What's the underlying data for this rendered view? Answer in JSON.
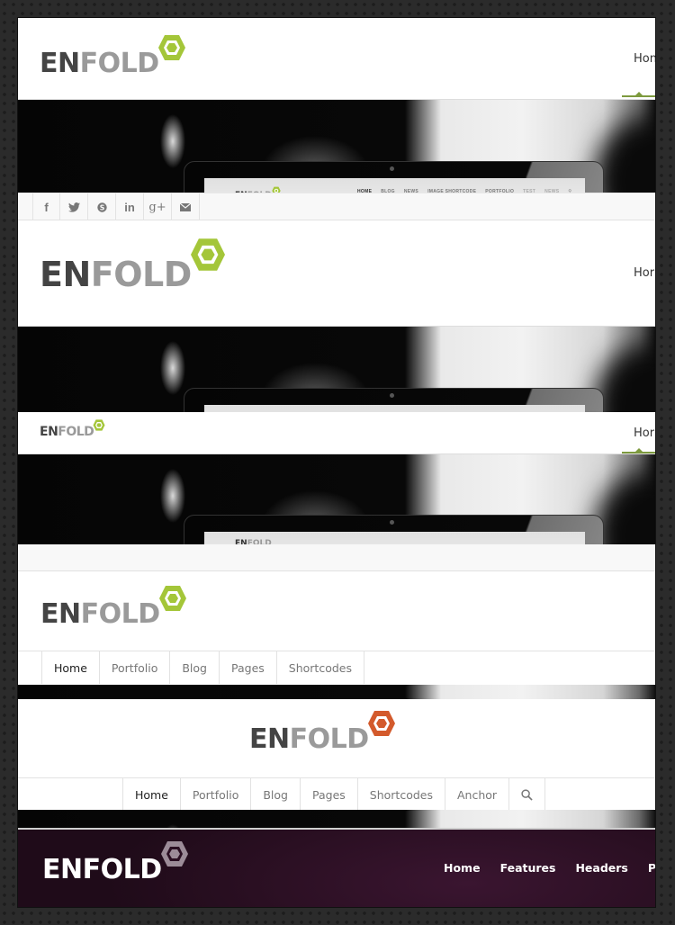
{
  "brand": {
    "logo_en": "EN",
    "logo_fold": "FOLD",
    "accent_green": "#a4c639",
    "accent_orange": "#d35a2c",
    "accent_muted": "#9c8c98",
    "nav_active_color": "#7d9a3e",
    "dark_header_color": "#2a0f22"
  },
  "variants": [
    {
      "name": "header-large-with-social-bar",
      "nav_visible": "Hon",
      "laptop_screen": {
        "nav": [
          "HOME",
          "BLOG",
          "NEWS",
          "IMAGE SHORTCODE",
          "PORTFOLIO",
          "TEST",
          "NEWS"
        ]
      },
      "social_icons": [
        "facebook-icon",
        "twitter-icon",
        "skype-icon",
        "linkedin-icon",
        "googleplus-icon",
        "mail-icon"
      ],
      "social_glyphs": [
        "f",
        "t",
        "S",
        "in",
        "g+",
        "✉"
      ]
    },
    {
      "name": "header-extra-large",
      "nav_visible": "Hor"
    },
    {
      "name": "header-small-compact",
      "nav_visible": "Hor"
    },
    {
      "name": "header-logo-left-menu-below",
      "menu": [
        "Home",
        "Portfolio",
        "Blog",
        "Pages",
        "Shortcodes"
      ]
    },
    {
      "name": "header-logo-centered-menu-below",
      "menu": [
        "Home",
        "Portfolio",
        "Blog",
        "Pages",
        "Shortcodes",
        "Anchor"
      ],
      "search_icon": "search-icon"
    },
    {
      "name": "header-dark-transparent",
      "menu": [
        "Home",
        "Features",
        "Headers",
        "Po"
      ]
    }
  ]
}
